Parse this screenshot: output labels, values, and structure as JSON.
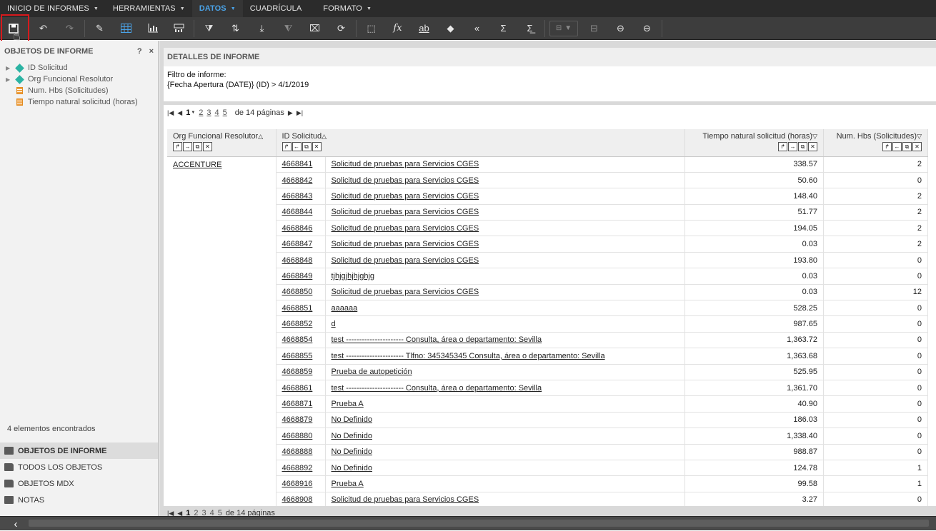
{
  "menu": {
    "items": [
      {
        "label": "INICIO DE INFORMES",
        "caret": true
      },
      {
        "label": "HERRAMIENTAS",
        "caret": true
      },
      {
        "label": "DATOS",
        "caret": true
      },
      {
        "label": "CUADRÍCULA",
        "caret": false
      },
      {
        "label": "FORMATO",
        "caret": true
      }
    ],
    "active": "DATOS",
    "active_color": "#4aa3e8"
  },
  "toolbar": {
    "icons": [
      "save-icon",
      "undo-icon",
      "redo-icon",
      "pencil-icon",
      "grid-icon",
      "chart-icon",
      "grid-chart-icon",
      "filter-icon",
      "sort-icon",
      "drill-icon",
      "clear-filter-icon",
      "remove-icon",
      "swap-icon",
      "edit-column-icon",
      "function-icon",
      "rename-icon",
      "back-icon",
      "collapse-icon",
      "sum-icon",
      "sum-rows-icon",
      "group-dropdown-icon",
      "ungroup-icon",
      "prev-group-icon",
      "next-group-icon"
    ]
  },
  "left_panel": {
    "title": "OBJETOS DE INFORME",
    "help": "?",
    "close": "×",
    "items": [
      {
        "label": "ID Solicitud",
        "type": "attribute"
      },
      {
        "label": "Org Funcional Resolutor",
        "type": "attribute"
      },
      {
        "label": "Num. Hbs (Solicitudes)",
        "type": "measure"
      },
      {
        "label": "Tiempo natural solicitud (horas)",
        "type": "measure"
      }
    ],
    "found": "4 elementos encontrados",
    "nav": [
      {
        "label": "OBJETOS DE INFORME",
        "active": true
      },
      {
        "label": "TODOS LOS OBJETOS",
        "active": false
      },
      {
        "label": "OBJETOS MDX",
        "active": false
      },
      {
        "label": "NOTAS",
        "active": false
      }
    ]
  },
  "details": {
    "title": "DETALLES DE INFORME",
    "filter_label": "Filtro de informe:",
    "filter_value": "{Fecha Apertura (DATE)} (ID) > 4/1/2019"
  },
  "pager": {
    "current": "1",
    "pages": [
      "2",
      "3",
      "4",
      "5"
    ],
    "total": "de 14 páginas"
  },
  "table": {
    "headers": {
      "org": "Org Funcional Resolutor",
      "id": "ID Solicitud",
      "tiempo": "Tiempo natural solicitud (horas)",
      "hbs": "Num. Hbs (Solicitudes)"
    },
    "group": "ACCENTURE",
    "rows": [
      {
        "id": "4668841",
        "desc": "Solicitud de pruebas para Servicios CGES",
        "tiempo": "338.57",
        "hbs": "2"
      },
      {
        "id": "4668842",
        "desc": "Solicitud de pruebas para Servicios CGES",
        "tiempo": "50.60",
        "hbs": "0"
      },
      {
        "id": "4668843",
        "desc": "Solicitud de pruebas para Servicios CGES",
        "tiempo": "148.40",
        "hbs": "2"
      },
      {
        "id": "4668844",
        "desc": "Solicitud de pruebas para Servicios CGES",
        "tiempo": "51.77",
        "hbs": "2"
      },
      {
        "id": "4668846",
        "desc": "Solicitud de pruebas para Servicios CGES",
        "tiempo": "194.05",
        "hbs": "2"
      },
      {
        "id": "4668847",
        "desc": "Solicitud de pruebas para Servicios CGES",
        "tiempo": "0.03",
        "hbs": "2"
      },
      {
        "id": "4668848",
        "desc": "Solicitud de pruebas para Servicios CGES",
        "tiempo": "193.80",
        "hbs": "0"
      },
      {
        "id": "4668849",
        "desc": "tjhjgjhjhjghjg",
        "tiempo": "0.03",
        "hbs": "0"
      },
      {
        "id": "4668850",
        "desc": "Solicitud de pruebas para Servicios CGES",
        "tiempo": "0.03",
        "hbs": "12"
      },
      {
        "id": "4668851",
        "desc": "aaaaaa",
        "tiempo": "528.25",
        "hbs": "0"
      },
      {
        "id": "4668852",
        "desc": "d",
        "tiempo": "987.65",
        "hbs": "0"
      },
      {
        "id": "4668854",
        "desc": "test ---------------------- Consulta, área o departamento: Sevilla",
        "tiempo": "1,363.72",
        "hbs": "0"
      },
      {
        "id": "4668855",
        "desc": "test ---------------------- Tlfno: 345345345 Consulta, área o departamento: Sevilla",
        "tiempo": "1,363.68",
        "hbs": "0"
      },
      {
        "id": "4668859",
        "desc": "Prueba de autopetición",
        "tiempo": "525.95",
        "hbs": "0"
      },
      {
        "id": "4668861",
        "desc": "test ---------------------- Consulta, área o departamento: Sevilla",
        "tiempo": "1,361.70",
        "hbs": "0"
      },
      {
        "id": "4668871",
        "desc": "Prueba A",
        "tiempo": "40.90",
        "hbs": "0"
      },
      {
        "id": "4668879",
        "desc": "No Definido",
        "tiempo": "186.03",
        "hbs": "0"
      },
      {
        "id": "4668880",
        "desc": "No Definido",
        "tiempo": "1,338.40",
        "hbs": "0"
      },
      {
        "id": "4668888",
        "desc": "No Definido",
        "tiempo": "988.87",
        "hbs": "0"
      },
      {
        "id": "4668892",
        "desc": "No Definido",
        "tiempo": "124.78",
        "hbs": "1"
      },
      {
        "id": "4668916",
        "desc": "Prueba A",
        "tiempo": "99.58",
        "hbs": "1"
      },
      {
        "id": "4668908",
        "desc": "Solicitud de pruebas para Servicios CGES",
        "tiempo": "3.27",
        "hbs": "0"
      }
    ]
  }
}
